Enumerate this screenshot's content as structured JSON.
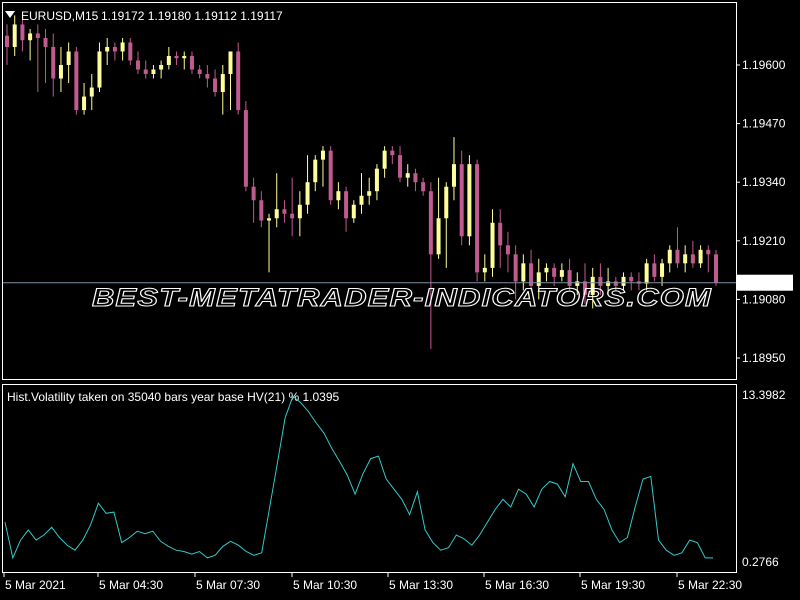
{
  "window": {
    "symbol_title": "EURUSD,M15",
    "ohlc": "1.19172 1.19180 1.19112 1.19117",
    "watermark": "BEST-METATRADER-INDICATORS.COM",
    "colors": {
      "background": "#000000",
      "frame": "#ffffff",
      "bull": "#ffff99",
      "bear": "#c05b90",
      "volatility": "#33c9c9",
      "price_line": "#7f8f9f"
    }
  },
  "chart_data": [
    {
      "type": "candlestick",
      "title": "EURUSD,M15",
      "y_tick_labels": [
        "1.19600",
        "1.19470",
        "1.19340",
        "1.19210",
        "1.19080",
        "1.18950"
      ],
      "ylim": [
        1.1886,
        1.1976
      ],
      "current_price": 1.19117,
      "current_price_label": "1.19117",
      "grid": false,
      "candles": [
        {
          "o": 1.19665,
          "h": 1.1969,
          "l": 1.196,
          "c": 1.1964
        },
        {
          "o": 1.1964,
          "h": 1.1971,
          "l": 1.1962,
          "c": 1.1969
        },
        {
          "o": 1.1969,
          "h": 1.197,
          "l": 1.1963,
          "c": 1.19655
        },
        {
          "o": 1.19655,
          "h": 1.1968,
          "l": 1.1961,
          "c": 1.1967
        },
        {
          "o": 1.1967,
          "h": 1.1969,
          "l": 1.1954,
          "c": 1.1966
        },
        {
          "o": 1.1966,
          "h": 1.1968,
          "l": 1.1956,
          "c": 1.1964
        },
        {
          "o": 1.1964,
          "h": 1.1967,
          "l": 1.1953,
          "c": 1.1957
        },
        {
          "o": 1.1957,
          "h": 1.1964,
          "l": 1.1954,
          "c": 1.196
        },
        {
          "o": 1.196,
          "h": 1.1965,
          "l": 1.1956,
          "c": 1.1963
        },
        {
          "o": 1.1963,
          "h": 1.1964,
          "l": 1.1949,
          "c": 1.195
        },
        {
          "o": 1.195,
          "h": 1.1956,
          "l": 1.1949,
          "c": 1.1953
        },
        {
          "o": 1.1953,
          "h": 1.1958,
          "l": 1.195,
          "c": 1.1955
        },
        {
          "o": 1.1955,
          "h": 1.1965,
          "l": 1.1954,
          "c": 1.1963
        },
        {
          "o": 1.1963,
          "h": 1.1966,
          "l": 1.196,
          "c": 1.1964
        },
        {
          "o": 1.1964,
          "h": 1.1965,
          "l": 1.1961,
          "c": 1.1963
        },
        {
          "o": 1.1963,
          "h": 1.1966,
          "l": 1.1961,
          "c": 1.1965
        },
        {
          "o": 1.1965,
          "h": 1.1966,
          "l": 1.196,
          "c": 1.1961
        },
        {
          "o": 1.1961,
          "h": 1.1963,
          "l": 1.1958,
          "c": 1.1959
        },
        {
          "o": 1.1959,
          "h": 1.1961,
          "l": 1.1957,
          "c": 1.1958
        },
        {
          "o": 1.1958,
          "h": 1.196,
          "l": 1.1957,
          "c": 1.1959
        },
        {
          "o": 1.1959,
          "h": 1.1961,
          "l": 1.1957,
          "c": 1.196
        },
        {
          "o": 1.196,
          "h": 1.1964,
          "l": 1.1959,
          "c": 1.1962
        },
        {
          "o": 1.1962,
          "h": 1.1963,
          "l": 1.196,
          "c": 1.19615
        },
        {
          "o": 1.19615,
          "h": 1.1963,
          "l": 1.1959,
          "c": 1.1962
        },
        {
          "o": 1.1962,
          "h": 1.1963,
          "l": 1.1958,
          "c": 1.1959
        },
        {
          "o": 1.1959,
          "h": 1.196,
          "l": 1.1957,
          "c": 1.1958
        },
        {
          "o": 1.1958,
          "h": 1.196,
          "l": 1.1955,
          "c": 1.1957
        },
        {
          "o": 1.1957,
          "h": 1.1959,
          "l": 1.1953,
          "c": 1.1954
        },
        {
          "o": 1.1954,
          "h": 1.196,
          "l": 1.1949,
          "c": 1.1958
        },
        {
          "o": 1.1958,
          "h": 1.1962,
          "l": 1.195,
          "c": 1.1963
        },
        {
          "o": 1.1963,
          "h": 1.1965,
          "l": 1.1949,
          "c": 1.195
        },
        {
          "o": 1.195,
          "h": 1.1952,
          "l": 1.1932,
          "c": 1.1933
        },
        {
          "o": 1.1933,
          "h": 1.1935,
          "l": 1.1925,
          "c": 1.193
        },
        {
          "o": 1.193,
          "h": 1.1932,
          "l": 1.1924,
          "c": 1.19255
        },
        {
          "o": 1.19255,
          "h": 1.1927,
          "l": 1.1914,
          "c": 1.1926
        },
        {
          "o": 1.1926,
          "h": 1.1936,
          "l": 1.1924,
          "c": 1.1928
        },
        {
          "o": 1.1928,
          "h": 1.193,
          "l": 1.1925,
          "c": 1.1927
        },
        {
          "o": 1.1927,
          "h": 1.1935,
          "l": 1.1922,
          "c": 1.1926
        },
        {
          "o": 1.1926,
          "h": 1.1932,
          "l": 1.1922,
          "c": 1.1929
        },
        {
          "o": 1.1929,
          "h": 1.194,
          "l": 1.1927,
          "c": 1.1934
        },
        {
          "o": 1.1934,
          "h": 1.194,
          "l": 1.1932,
          "c": 1.1939
        },
        {
          "o": 1.1939,
          "h": 1.1942,
          "l": 1.1933,
          "c": 1.1941
        },
        {
          "o": 1.1941,
          "h": 1.1942,
          "l": 1.1929,
          "c": 1.193
        },
        {
          "o": 1.193,
          "h": 1.1934,
          "l": 1.1928,
          "c": 1.1932
        },
        {
          "o": 1.1932,
          "h": 1.1933,
          "l": 1.1923,
          "c": 1.1926
        },
        {
          "o": 1.1926,
          "h": 1.193,
          "l": 1.1925,
          "c": 1.1929
        },
        {
          "o": 1.1929,
          "h": 1.1936,
          "l": 1.1927,
          "c": 1.1931
        },
        {
          "o": 1.1931,
          "h": 1.1935,
          "l": 1.1929,
          "c": 1.1932
        },
        {
          "o": 1.1932,
          "h": 1.1938,
          "l": 1.193,
          "c": 1.1937
        },
        {
          "o": 1.1937,
          "h": 1.1942,
          "l": 1.1935,
          "c": 1.1941
        },
        {
          "o": 1.1941,
          "h": 1.1942,
          "l": 1.1938,
          "c": 1.194
        },
        {
          "o": 1.194,
          "h": 1.1942,
          "l": 1.1934,
          "c": 1.1935
        },
        {
          "o": 1.1935,
          "h": 1.1938,
          "l": 1.1933,
          "c": 1.1936
        },
        {
          "o": 1.1936,
          "h": 1.1937,
          "l": 1.1932,
          "c": 1.1934
        },
        {
          "o": 1.1934,
          "h": 1.1935,
          "l": 1.1931,
          "c": 1.1932
        },
        {
          "o": 1.1932,
          "h": 1.1934,
          "l": 1.1897,
          "c": 1.1918
        },
        {
          "o": 1.1918,
          "h": 1.1935,
          "l": 1.1917,
          "c": 1.1926
        },
        {
          "o": 1.1926,
          "h": 1.1934,
          "l": 1.1915,
          "c": 1.1933
        },
        {
          "o": 1.1933,
          "h": 1.1944,
          "l": 1.193,
          "c": 1.1938
        },
        {
          "o": 1.1938,
          "h": 1.1941,
          "l": 1.192,
          "c": 1.1922
        },
        {
          "o": 1.1922,
          "h": 1.194,
          "l": 1.192,
          "c": 1.1938
        },
        {
          "o": 1.1938,
          "h": 1.1939,
          "l": 1.1912,
          "c": 1.1914
        },
        {
          "o": 1.1914,
          "h": 1.1918,
          "l": 1.1912,
          "c": 1.1915
        },
        {
          "o": 1.1915,
          "h": 1.1928,
          "l": 1.1913,
          "c": 1.1925
        },
        {
          "o": 1.1925,
          "h": 1.1928,
          "l": 1.1915,
          "c": 1.192
        },
        {
          "o": 1.192,
          "h": 1.1923,
          "l": 1.1914,
          "c": 1.1918
        },
        {
          "o": 1.1918,
          "h": 1.192,
          "l": 1.1908,
          "c": 1.1912
        },
        {
          "o": 1.1912,
          "h": 1.1918,
          "l": 1.191,
          "c": 1.1916
        },
        {
          "o": 1.1916,
          "h": 1.1919,
          "l": 1.191,
          "c": 1.1911
        },
        {
          "o": 1.1911,
          "h": 1.1917,
          "l": 1.1908,
          "c": 1.1914
        },
        {
          "o": 1.1914,
          "h": 1.1916,
          "l": 1.1912,
          "c": 1.1915
        },
        {
          "o": 1.1915,
          "h": 1.1916,
          "l": 1.1911,
          "c": 1.1913
        },
        {
          "o": 1.1913,
          "h": 1.1916,
          "l": 1.1912,
          "c": 1.19145
        },
        {
          "o": 1.19145,
          "h": 1.1917,
          "l": 1.191,
          "c": 1.1911
        },
        {
          "o": 1.1911,
          "h": 1.1914,
          "l": 1.1909,
          "c": 1.1912
        },
        {
          "o": 1.1912,
          "h": 1.1916,
          "l": 1.1907,
          "c": 1.1909
        },
        {
          "o": 1.1909,
          "h": 1.1915,
          "l": 1.1906,
          "c": 1.1913
        },
        {
          "o": 1.1913,
          "h": 1.1916,
          "l": 1.1909,
          "c": 1.1911
        },
        {
          "o": 1.1911,
          "h": 1.1915,
          "l": 1.1909,
          "c": 1.1912
        },
        {
          "o": 1.1912,
          "h": 1.1913,
          "l": 1.191,
          "c": 1.1911
        },
        {
          "o": 1.1911,
          "h": 1.1914,
          "l": 1.191,
          "c": 1.1913
        },
        {
          "o": 1.1913,
          "h": 1.1914,
          "l": 1.191,
          "c": 1.1912
        },
        {
          "o": 1.1912,
          "h": 1.1914,
          "l": 1.191,
          "c": 1.19115
        },
        {
          "o": 1.19115,
          "h": 1.1917,
          "l": 1.191,
          "c": 1.1916
        },
        {
          "o": 1.1916,
          "h": 1.1918,
          "l": 1.1912,
          "c": 1.1913
        },
        {
          "o": 1.1913,
          "h": 1.1917,
          "l": 1.1911,
          "c": 1.1916
        },
        {
          "o": 1.1916,
          "h": 1.192,
          "l": 1.1914,
          "c": 1.1919
        },
        {
          "o": 1.1919,
          "h": 1.1924,
          "l": 1.1915,
          "c": 1.1916
        },
        {
          "o": 1.1916,
          "h": 1.192,
          "l": 1.1914,
          "c": 1.1918
        },
        {
          "o": 1.1918,
          "h": 1.1921,
          "l": 1.1915,
          "c": 1.1916
        },
        {
          "o": 1.1916,
          "h": 1.192,
          "l": 1.1915,
          "c": 1.1919
        },
        {
          "o": 1.1919,
          "h": 1.192,
          "l": 1.1914,
          "c": 1.1918
        },
        {
          "o": 1.1918,
          "h": 1.1919,
          "l": 1.1911,
          "c": 1.19117
        }
      ]
    },
    {
      "type": "line",
      "title": "Hist.Volatility  taken on 35040 bars year base  HV(21) %  1.0395",
      "y_tick_labels": [
        "13.3982",
        "0.2766"
      ],
      "ylim": [
        0.2766,
        13.3982
      ],
      "grid": false,
      "series": [
        {
          "values": [
            3.4,
            0.6,
            2.0,
            2.8,
            2.0,
            2.4,
            3.0,
            2.2,
            1.6,
            1.2,
            2.0,
            3.2,
            4.9,
            4.1,
            4.2,
            1.8,
            2.2,
            2.7,
            2.5,
            2.7,
            1.9,
            1.5,
            1.2,
            1.1,
            0.9,
            1.1,
            0.6,
            0.8,
            1.5,
            1.9,
            1.6,
            1.1,
            0.8,
            1.0,
            4.5,
            8.0,
            11.6,
            13.3,
            12.8,
            12.1,
            11.2,
            10.4,
            9.2,
            8.2,
            7.1,
            5.6,
            7.2,
            8.4,
            8.6,
            6.8,
            6.0,
            5.2,
            4.0,
            5.8,
            2.8,
            1.8,
            1.2,
            1.4,
            2.4,
            2.1,
            1.6,
            2.4,
            3.4,
            4.4,
            5.2,
            4.6,
            6.0,
            5.6,
            4.6,
            6.0,
            6.6,
            6.4,
            5.4,
            8.0,
            6.6,
            6.6,
            5.2,
            4.4,
            2.8,
            1.8,
            2.2,
            4.6,
            6.8,
            7.0,
            2.0,
            1.2,
            0.8,
            1.0,
            2.0,
            1.8,
            0.6,
            0.6
          ]
        }
      ]
    }
  ],
  "x_tick_labels": [
    "5 Mar 2021",
    "5 Mar 04:30",
    "5 Mar 07:30",
    "5 Mar 10:30",
    "5 Mar 13:30",
    "5 Mar 16:30",
    "5 Mar 19:30",
    "5 Mar 22:30"
  ]
}
